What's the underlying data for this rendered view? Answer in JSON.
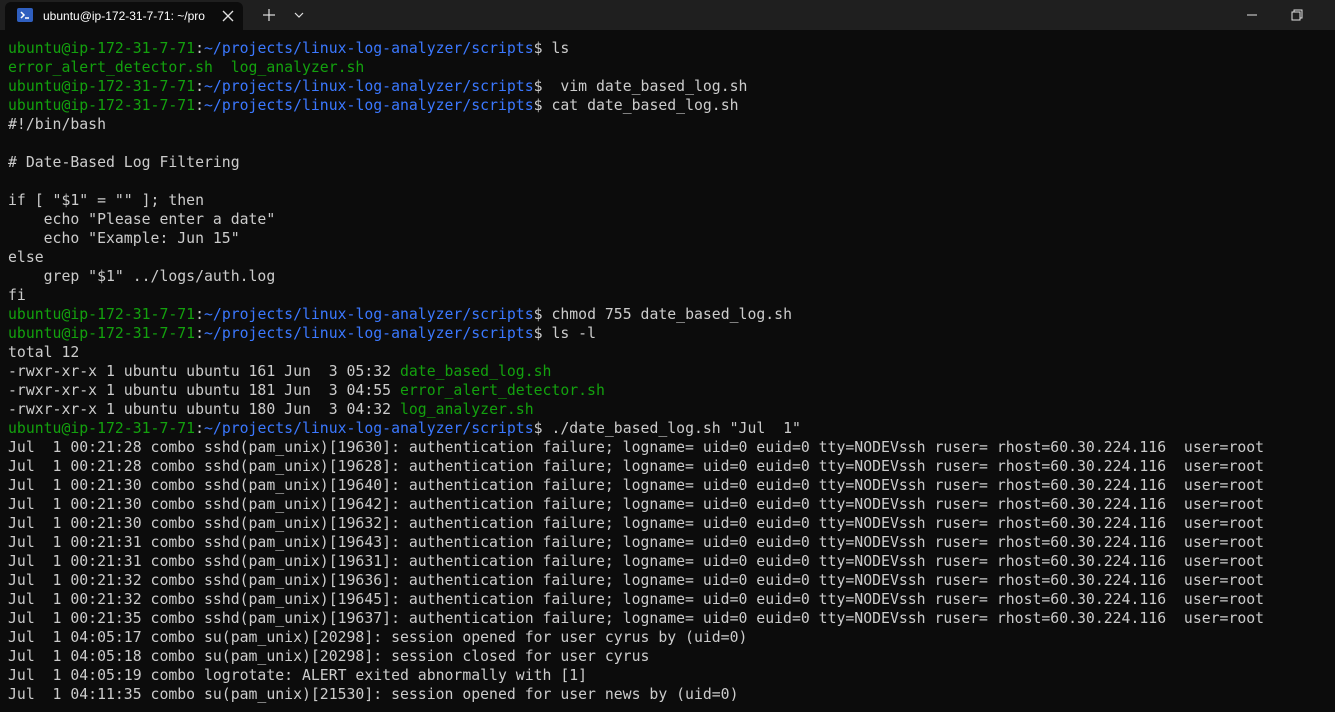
{
  "window": {
    "tab_title": "ubuntu@ip-172-31-7-71: ~/pro",
    "icons": {
      "tab": "terminal-icon",
      "close": "close-icon",
      "new_tab": "plus-icon",
      "dropdown": "chevron-down-icon",
      "minimize": "minimize-icon",
      "maximize": "restore-icon"
    }
  },
  "colors": {
    "background": "#0c0c0c",
    "titlebar": "#1f1f1f",
    "text": "#cccccc",
    "prompt_user": "#13a10e",
    "prompt_path": "#3b78ff",
    "executable": "#13a10e"
  },
  "prompt": {
    "user": "ubuntu@ip-172-31-7-71",
    "path": "~/projects/linux-log-analyzer/scripts",
    "symbol": "$ "
  },
  "terminal": {
    "lines": [
      {
        "type": "prompt",
        "cmd": "ls"
      },
      {
        "type": "files",
        "text": "error_alert_detector.sh  log_analyzer.sh"
      },
      {
        "type": "prompt",
        "cmd": " vim date_based_log.sh"
      },
      {
        "type": "prompt",
        "cmd": "cat date_based_log.sh"
      },
      {
        "type": "out",
        "text": "#!/bin/bash"
      },
      {
        "type": "out",
        "text": ""
      },
      {
        "type": "out",
        "text": "# Date-Based Log Filtering"
      },
      {
        "type": "out",
        "text": ""
      },
      {
        "type": "out",
        "text": "if [ \"$1\" = \"\" ]; then"
      },
      {
        "type": "out",
        "text": "    echo \"Please enter a date\""
      },
      {
        "type": "out",
        "text": "    echo \"Example: Jun 15\""
      },
      {
        "type": "out",
        "text": "else"
      },
      {
        "type": "out",
        "text": "    grep \"$1\" ../logs/auth.log"
      },
      {
        "type": "out",
        "text": "fi"
      },
      {
        "type": "prompt",
        "cmd": "chmod 755 date_based_log.sh"
      },
      {
        "type": "prompt",
        "cmd": "ls -l"
      },
      {
        "type": "out",
        "text": "total 12"
      },
      {
        "type": "lsl",
        "text": "-rwxr-xr-x 1 ubuntu ubuntu 161 Jun  3 05:32 ",
        "file": "date_based_log.sh"
      },
      {
        "type": "lsl",
        "text": "-rwxr-xr-x 1 ubuntu ubuntu 181 Jun  3 04:55 ",
        "file": "error_alert_detector.sh"
      },
      {
        "type": "lsl",
        "text": "-rwxr-xr-x 1 ubuntu ubuntu 180 Jun  3 04:32 ",
        "file": "log_analyzer.sh"
      },
      {
        "type": "prompt",
        "cmd": "./date_based_log.sh \"Jul  1\""
      },
      {
        "type": "out",
        "text": "Jul  1 00:21:28 combo sshd(pam_unix)[19630]: authentication failure; logname= uid=0 euid=0 tty=NODEVssh ruser= rhost=60.30.224.116  user=root"
      },
      {
        "type": "out",
        "text": "Jul  1 00:21:28 combo sshd(pam_unix)[19628]: authentication failure; logname= uid=0 euid=0 tty=NODEVssh ruser= rhost=60.30.224.116  user=root"
      },
      {
        "type": "out",
        "text": "Jul  1 00:21:30 combo sshd(pam_unix)[19640]: authentication failure; logname= uid=0 euid=0 tty=NODEVssh ruser= rhost=60.30.224.116  user=root"
      },
      {
        "type": "out",
        "text": "Jul  1 00:21:30 combo sshd(pam_unix)[19642]: authentication failure; logname= uid=0 euid=0 tty=NODEVssh ruser= rhost=60.30.224.116  user=root"
      },
      {
        "type": "out",
        "text": "Jul  1 00:21:30 combo sshd(pam_unix)[19632]: authentication failure; logname= uid=0 euid=0 tty=NODEVssh ruser= rhost=60.30.224.116  user=root"
      },
      {
        "type": "out",
        "text": "Jul  1 00:21:31 combo sshd(pam_unix)[19643]: authentication failure; logname= uid=0 euid=0 tty=NODEVssh ruser= rhost=60.30.224.116  user=root"
      },
      {
        "type": "out",
        "text": "Jul  1 00:21:31 combo sshd(pam_unix)[19631]: authentication failure; logname= uid=0 euid=0 tty=NODEVssh ruser= rhost=60.30.224.116  user=root"
      },
      {
        "type": "out",
        "text": "Jul  1 00:21:32 combo sshd(pam_unix)[19636]: authentication failure; logname= uid=0 euid=0 tty=NODEVssh ruser= rhost=60.30.224.116  user=root"
      },
      {
        "type": "out",
        "text": "Jul  1 00:21:32 combo sshd(pam_unix)[19645]: authentication failure; logname= uid=0 euid=0 tty=NODEVssh ruser= rhost=60.30.224.116  user=root"
      },
      {
        "type": "out",
        "text": "Jul  1 00:21:35 combo sshd(pam_unix)[19637]: authentication failure; logname= uid=0 euid=0 tty=NODEVssh ruser= rhost=60.30.224.116  user=root"
      },
      {
        "type": "out",
        "text": "Jul  1 04:05:17 combo su(pam_unix)[20298]: session opened for user cyrus by (uid=0)"
      },
      {
        "type": "out",
        "text": "Jul  1 04:05:18 combo su(pam_unix)[20298]: session closed for user cyrus"
      },
      {
        "type": "out",
        "text": "Jul  1 04:05:19 combo logrotate: ALERT exited abnormally with [1]"
      },
      {
        "type": "out",
        "text": "Jul  1 04:11:35 combo su(pam_unix)[21530]: session opened for user news by (uid=0)"
      }
    ]
  }
}
